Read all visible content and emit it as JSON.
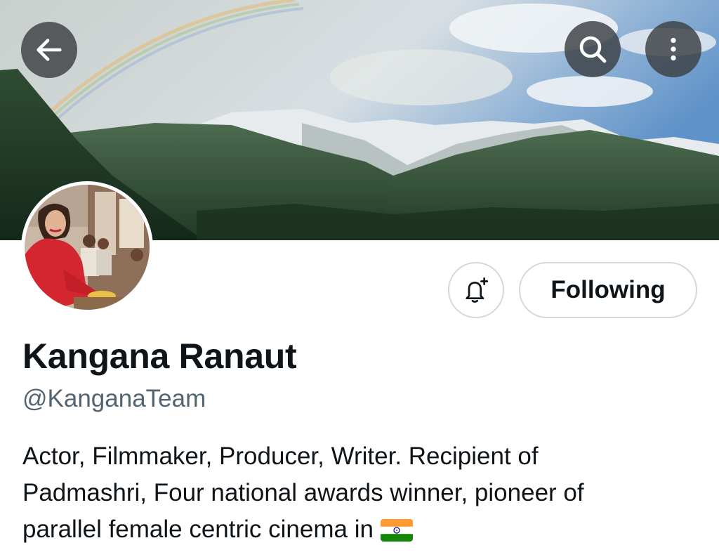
{
  "header": {
    "back_icon": "arrow-left-icon",
    "search_icon": "search-icon",
    "more_icon": "more-vertical-icon"
  },
  "profile": {
    "display_name": "Kangana Ranaut",
    "handle": "@KanganaTeam",
    "bio_lines": [
      "Actor, Filmmaker, Producer, Writer. Recipient of",
      "Padmashri, Four national awards winner, pioneer of",
      "parallel female centric cinema in"
    ],
    "bio_emoji": "india-flag-icon"
  },
  "actions": {
    "notify_icon": "bell-plus-icon",
    "follow_label": "Following"
  },
  "colors": {
    "text_primary": "#0f1419",
    "text_secondary": "#536471",
    "button_border": "#cfd9de",
    "overlay_button": "#3c4043"
  }
}
